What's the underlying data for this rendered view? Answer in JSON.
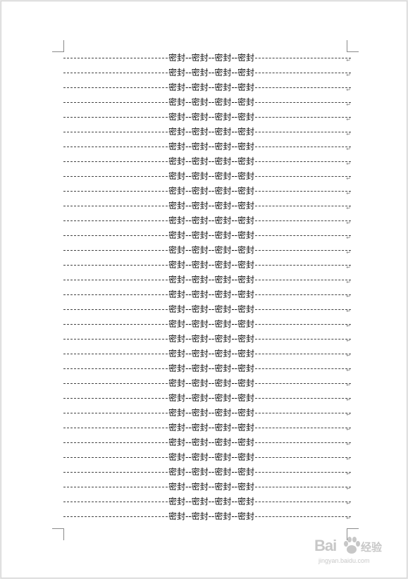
{
  "document": {
    "seal_text": "密封--密封--密封--密封",
    "line_count": 32,
    "paragraph_mark": "↵"
  },
  "watermark": {
    "logo": "Bai",
    "word": "经验",
    "url": "jingyan.baidu.com"
  }
}
